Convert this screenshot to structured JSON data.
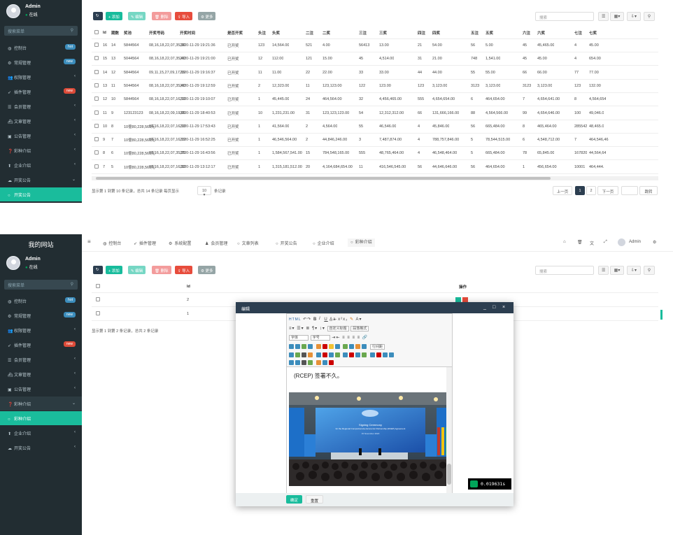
{
  "top": {
    "sidebar": {
      "user_name": "Admin",
      "status": "在线",
      "search_placeholder": "搜索菜单",
      "items": [
        {
          "label": "控制台",
          "icon": "dashboard-icon",
          "badge": "hot",
          "badge_color": "#3c8dbc"
        },
        {
          "label": "常规管理",
          "icon": "cogs-icon",
          "badge": "new",
          "badge_color": "#3c8dbc"
        },
        {
          "label": "权限管理",
          "icon": "group-icon",
          "arrow": "‹"
        },
        {
          "label": "插件管理",
          "icon": "rocket-icon",
          "badge": "new",
          "badge_color": "#dd4b39"
        },
        {
          "label": "会员管理",
          "icon": "list-icon",
          "arrow": "‹"
        },
        {
          "label": "文章管理",
          "icon": "ship-icon",
          "arrow": "‹"
        },
        {
          "label": "公告管理",
          "icon": "notice-icon",
          "arrow": "‹"
        },
        {
          "label": "彩种介绍",
          "icon": "question-icon",
          "arrow": "‹"
        },
        {
          "label": "企业介绍",
          "icon": "up-icon",
          "arrow": "‹"
        },
        {
          "label": "开奖公告",
          "icon": "cloud-icon",
          "arrow": "⌄"
        },
        {
          "label": "开奖公告",
          "icon": "circle-icon",
          "active": true
        }
      ]
    },
    "toolbar": {
      "refresh": "↻",
      "add": "+ 添加",
      "edit": "✎ 编辑",
      "delete": "🗑 删除",
      "import": "⇪ 导入",
      "more": "⚙ 更多",
      "search_placeholder": "搜索"
    },
    "table": {
      "headers": [
        "Id",
        "期数",
        "奖池",
        "开奖号码",
        "开奖时间",
        "是否开奖",
        "头注",
        "头奖",
        "二注",
        "二奖",
        "三注",
        "三奖",
        "四注",
        "四奖",
        "五注",
        "五奖",
        "六注",
        "六奖",
        "七注",
        "七奖"
      ],
      "rows": [
        [
          "16",
          "14",
          "5844564",
          "08,16,18,22,07,35,36",
          "2020-11-29 19:21:36",
          "已开奖",
          "123",
          "14,564.00",
          "521",
          "4.00",
          "56413",
          "13.00",
          "21",
          "54.00",
          "56",
          "5.00",
          "45",
          "45,465.00",
          "4",
          "45.00"
        ],
        [
          "15",
          "13",
          "5044564",
          "08,16,18,22,07,35,40",
          "2020-11-29 19:21:00",
          "已开奖",
          "12",
          "112.00",
          "121",
          "15.00",
          "45",
          "4,514.00",
          "31",
          "21.00",
          "748",
          "1,541.00",
          "45",
          "45.00",
          "4",
          "654.00"
        ],
        [
          "14",
          "12",
          "5844564",
          "09,11,15,27,09,17,19",
          "2020-11-29 19:16:37",
          "已开奖",
          "11",
          "11.00",
          "22",
          "22.00",
          "33",
          "33.00",
          "44",
          "44.00",
          "55",
          "55.00",
          "66",
          "66.00",
          "77",
          "77.00"
        ],
        [
          "13",
          "11",
          "5044564",
          "08,16,18,22,07,35,40",
          "2020-11-29 19:12:59",
          "已开奖",
          "2",
          "12,323.00",
          "11",
          "123,123.00",
          "122",
          "123.00",
          "123",
          "3,123.00",
          "3123",
          "3,123.00",
          "3123",
          "3,123.00",
          "123",
          "132.00"
        ],
        [
          "12",
          "10",
          "5844564",
          "08,16,18,22,07,16,18",
          "2020-11-29 19:10:07",
          "已开奖",
          "1",
          "45,445.00",
          "24",
          "464,564.00",
          "32",
          "4,456,465.00",
          "555",
          "4,654,654.00",
          "6",
          "464,654.00",
          "7",
          "4,654,641.00",
          "8",
          "4,564,654"
        ],
        [
          "11",
          "9",
          "123123123",
          "08,16,18,22,09,19,05",
          "2020-11-29 18:40:53",
          "已开奖",
          "10",
          "1,231,231.00",
          "31",
          "123,123,123.00",
          "54",
          "12,312,312.00",
          "66",
          "131,666,166.00",
          "88",
          "4,564,566.00",
          "99",
          "4,654,646.00",
          "100",
          "49,046.0"
        ],
        [
          "10",
          "8",
          "10億80,228,561元",
          "08,16,18,22,07,16,18",
          "2020-11-29 17:53:43",
          "已开奖",
          "1",
          "41,564.00",
          "2",
          "4,564.00",
          "55",
          "46,546.00",
          "4",
          "45,846.00",
          "56",
          "665,484.00",
          "8",
          "465,464.00",
          "285542",
          "48,465.0"
        ],
        [
          "9",
          "7",
          "10億80,228,561元",
          "08,16,18,22,07,16,19",
          "2020-11-29 16:52:25",
          "已开奖",
          "1",
          "46,546,564.00",
          "2",
          "44,846,246.00",
          "3",
          "7,487,874.00",
          "4",
          "788,757,846.00",
          "5",
          "78,544,515.00",
          "6",
          "4,548,712.00",
          "7",
          "464,546,46"
        ],
        [
          "8",
          "6",
          "10億80,228,561元",
          "08,16,18,22,07,35,25",
          "2020-11-29 16:43:56",
          "已开奖",
          "1",
          "1,584,567,541.00",
          "15",
          "784,548,165.00",
          "555",
          "48,765,464.00",
          "4",
          "46,548,464.00",
          "5",
          "665,484.00",
          "78",
          "65,845.00",
          "167820",
          "44,564,64"
        ],
        [
          "7",
          "5",
          "10億80,228,561元",
          "08,16,18,22,07,16,33",
          "2020-11-29 13:12:17",
          "已开奖",
          "1",
          "1,315,181,512.00",
          "20",
          "4,164,684,654.00",
          "11",
          "416,546,545.00",
          "56",
          "44,646,646.00",
          "56",
          "464,654.00",
          "1",
          "456,654.00",
          "10001",
          "464,444."
        ]
      ]
    },
    "pagination": {
      "summary": "显示第 1 到第 10 条记录，总共 14 条记录 每页显示",
      "page_size": "10 ▾",
      "per_page_suffix": "条记录",
      "prev": "上一页",
      "pages": [
        "1",
        "2"
      ],
      "next": "下一页",
      "jump": "跳转"
    }
  },
  "bottom": {
    "brand": "我的网站",
    "sidebar": {
      "user_name": "Admin",
      "status": "在线",
      "search_placeholder": "搜索菜单",
      "items": [
        {
          "label": "控制台",
          "icon": "dashboard-icon",
          "badge": "hot",
          "badge_color": "#3c8dbc"
        },
        {
          "label": "常规管理",
          "icon": "cogs-icon",
          "badge": "new",
          "badge_color": "#3c8dbc"
        },
        {
          "label": "权限管理",
          "icon": "group-icon",
          "arrow": "‹"
        },
        {
          "label": "插件管理",
          "icon": "rocket-icon",
          "badge": "new",
          "badge_color": "#dd4b39"
        },
        {
          "label": "会员管理",
          "icon": "list-icon",
          "arrow": "‹"
        },
        {
          "label": "文章管理",
          "icon": "ship-icon",
          "arrow": "‹"
        },
        {
          "label": "公告管理",
          "icon": "notice-icon",
          "arrow": "‹"
        },
        {
          "label": "彩种介绍",
          "icon": "question-icon",
          "arrow": "⌄",
          "open": true
        },
        {
          "label": "彩种介绍",
          "icon": "circle-icon",
          "active": true
        },
        {
          "label": "企业介绍",
          "icon": "up-icon",
          "arrow": "‹"
        },
        {
          "label": "开奖公告",
          "icon": "cloud-icon",
          "arrow": "‹"
        }
      ]
    },
    "topnav": {
      "menu": "≡",
      "tabs": [
        "控制台",
        "插件管理",
        "系统配置",
        "会员管理",
        "文章列表",
        "开奖公告",
        "企业介绍",
        "彩种介绍"
      ],
      "tab_icons": [
        "dashboard-icon",
        "rocket-icon",
        "cog-icon",
        "user-icon",
        "circle-icon",
        "circle-icon",
        "circle-icon",
        "circle-icon"
      ],
      "right_icons": [
        "home-icon",
        "trash-icon",
        "language-icon",
        "fullscreen-icon"
      ],
      "user": "Admin"
    },
    "table": {
      "headers": [
        "Id",
        "操作"
      ],
      "rows": [
        [
          "2"
        ],
        [
          "1"
        ]
      ],
      "summary": "显示第 1 到第 2 条记录，总共 2 条记录"
    },
    "modal": {
      "title": "编辑",
      "controls": [
        "_",
        "□",
        "×"
      ],
      "content_text": "(RCEP) 签署不久。",
      "timing": "0.019631s",
      "ok": "确定",
      "reset": "重置",
      "toolbar_font_label": "字体",
      "toolbar_size_label": "字号",
      "toolbar_para": "段落格式",
      "toolbar_custom": "自定义标题",
      "toolbar_row_spacing": "行间距",
      "photo_banner_line1": "Signing Ceremony",
      "photo_banner_line2": "for the Regional Comprehensive Economic Partnership (RCEP) Agreement",
      "photo_banner_line3": "15 November 2020"
    }
  }
}
